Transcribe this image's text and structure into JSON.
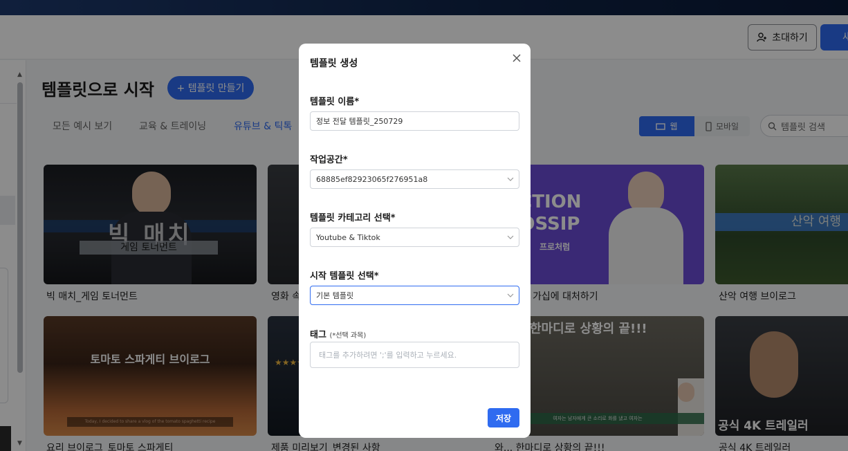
{
  "header": {
    "invite_label": "초대하기",
    "primary_label": "새"
  },
  "page": {
    "title": "템플릿으로 시작",
    "make_button": "+ 템플릿 만들기"
  },
  "tabs": [
    {
      "label": "모든 예시 보기"
    },
    {
      "label": "교육 & 트레이닝"
    },
    {
      "label": "유튜브 & 틱톡"
    }
  ],
  "view_toggle": {
    "web": "웹",
    "mobile": "모바일"
  },
  "search": {
    "placeholder": "템플릿 검색"
  },
  "cards": [
    {
      "label": "빅 매치_게임 토너먼트",
      "overlay_main": "빅 매치",
      "overlay_sub": "게임 토너먼트"
    },
    {
      "label": "영화 속"
    },
    {
      "label": "가십에 대처하기",
      "overlay_main": "ACTION GOSSIP",
      "overlay_sub": "프로처럼"
    },
    {
      "label": "산악 여행 브이로그",
      "overlay_main": "산악 여행"
    },
    {
      "label": "요리 브이로그_토마토 스파게티",
      "overlay_main": "토마토 스파게티 브이로그",
      "overlay_sub": "Today, I decided to share a vlog of the tomato spaghetti recipe"
    },
    {
      "label": "제품 미리보기_변경된 사항"
    },
    {
      "label": "와... 한마디로 상황의 끝!!!",
      "overlay_main": "한마디로 상황의 끝!!!",
      "overlay_sub": "여자는 남자에게 큰 소리로 화를 냈고 여자는"
    },
    {
      "label": "공식 4K 트레일러",
      "overlay_main": "공식 4K 트레일러"
    }
  ],
  "modal": {
    "title": "템플릿 생성",
    "name_label": "템플릿 이름*",
    "name_value": "정보 전달 템플릿_250729",
    "workspace_label": "작업공간*",
    "workspace_value": "68885ef82923065f276951a8",
    "category_label": "템플릿 카테고리 선택*",
    "category_value": "Youtube & Tiktok",
    "start_label": "시작 템플릿 선택*",
    "start_value": "기본 템플릿",
    "tag_label": "태그",
    "tag_optional": "(*선택 과목)",
    "tag_placeholder": "태그를 추가하려면 ';'를 입력하고 누르세요.",
    "save_label": "저장"
  },
  "colors": {
    "accent": "#2f6bf0",
    "topbar": "#0f2346"
  }
}
